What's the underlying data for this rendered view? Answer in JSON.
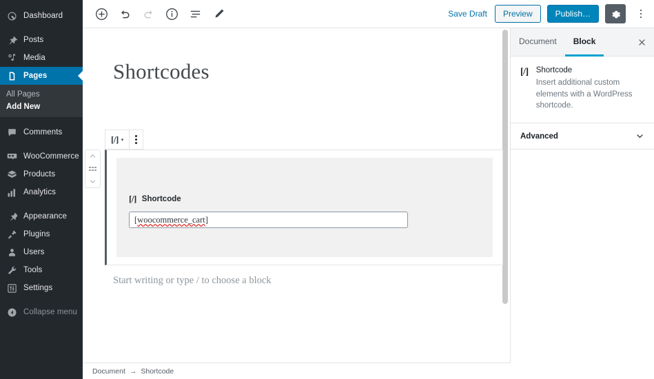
{
  "admin_sidebar": {
    "items": [
      {
        "label": "Dashboard",
        "icon": "dashboard-icon",
        "current": false,
        "gap": false
      },
      {
        "label": "Posts",
        "icon": "pin-icon",
        "current": false,
        "gap": true
      },
      {
        "label": "Media",
        "icon": "media-icon",
        "current": false,
        "gap": false
      },
      {
        "label": "Pages",
        "icon": "pages-icon",
        "current": true,
        "gap": false
      }
    ],
    "submenu": [
      {
        "label": "All Pages",
        "active": false
      },
      {
        "label": "Add New",
        "active": true
      }
    ],
    "items_after": [
      {
        "label": "Comments",
        "icon": "comments-icon",
        "gap": true
      },
      {
        "label": "WooCommerce",
        "icon": "woocommerce-icon",
        "gap": true
      },
      {
        "label": "Products",
        "icon": "products-icon",
        "gap": false
      },
      {
        "label": "Analytics",
        "icon": "analytics-icon",
        "gap": false
      },
      {
        "label": "Appearance",
        "icon": "appearance-icon",
        "gap": true
      },
      {
        "label": "Plugins",
        "icon": "plugins-icon",
        "gap": false
      },
      {
        "label": "Users",
        "icon": "users-icon",
        "gap": false
      },
      {
        "label": "Tools",
        "icon": "tools-icon",
        "gap": false
      },
      {
        "label": "Settings",
        "icon": "settings-icon",
        "gap": false
      }
    ],
    "collapse": {
      "label": "Collapse menu",
      "icon": "collapse-arrow-icon"
    },
    "colors": {
      "background": "#23282d",
      "submenu_background": "#32373c",
      "current": "#0073aa"
    }
  },
  "header": {
    "tools": [
      {
        "name": "add-block-button",
        "icon": "plus-circle-icon",
        "disabled": false
      },
      {
        "name": "undo-button",
        "icon": "undo-icon",
        "disabled": false
      },
      {
        "name": "redo-button",
        "icon": "redo-icon",
        "disabled": true
      },
      {
        "name": "content-info-button",
        "icon": "info-circle-icon",
        "disabled": false
      },
      {
        "name": "block-navigation-button",
        "icon": "list-view-icon",
        "disabled": false
      },
      {
        "name": "edit-mode-button",
        "icon": "pencil-icon",
        "disabled": false
      }
    ],
    "save_draft": "Save Draft",
    "preview": "Preview",
    "publish": "Publish…",
    "settings_icon": "gear-icon",
    "more_icon": "ellipsis-vertical-icon",
    "accent": "#0085ba"
  },
  "canvas": {
    "post_title": "Shortcodes",
    "block_toolbar": {
      "block_type_icon": "[/]",
      "caret": "▾",
      "more_icon": "ellipsis-vertical-icon"
    },
    "mover": {
      "up_icon": "chevron-up-icon",
      "drag_icon": "drag-grip-icon",
      "down_icon": "chevron-down-icon"
    },
    "shortcode_block": {
      "icon": "[/]",
      "label": "Shortcode",
      "value": "[woocommerce_cart]",
      "misspelled_part": "woocommerce_cart"
    },
    "default_appender": "Start writing or type / to choose a block"
  },
  "settings_sidebar": {
    "tabs": [
      {
        "label": "Document",
        "active": false
      },
      {
        "label": "Block",
        "active": true
      }
    ],
    "close_icon": "close-icon",
    "block_panel": {
      "icon": "[/]",
      "title": "Shortcode",
      "description": "Insert additional custom elements with a WordPress shortcode."
    },
    "advanced": {
      "label": "Advanced",
      "chevron": "chevron-down-icon"
    },
    "active_tab_color": "#00a0d2"
  },
  "footer": {
    "breadcrumb": [
      {
        "label": "Document"
      },
      {
        "label": "Shortcode"
      }
    ],
    "separator": "→"
  }
}
